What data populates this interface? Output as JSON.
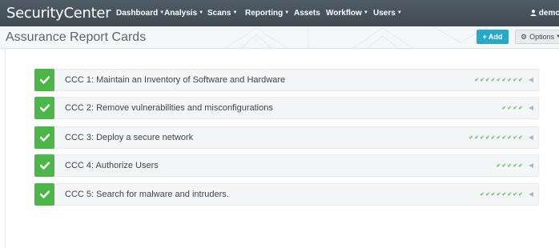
{
  "navbar": {
    "brand": "SecurityCenter",
    "items": [
      {
        "label": "Dashboard",
        "dropdown": true
      },
      {
        "label": "Analysis",
        "dropdown": true
      },
      {
        "label": "Scans",
        "dropdown": true
      },
      {
        "label": "Reporting",
        "dropdown": true
      },
      {
        "label": "Assets",
        "dropdown": false
      },
      {
        "label": "Workflow",
        "dropdown": true
      },
      {
        "label": "Users",
        "dropdown": true
      }
    ],
    "user": "demo",
    "user_icon": "user-icon"
  },
  "header": {
    "title": "Assurance Report Cards",
    "add_label": "Add",
    "options_label": "Options"
  },
  "cards": [
    {
      "label": "CCC 1: Maintain an Inventory of Software and Hardware",
      "checks": 9
    },
    {
      "label": "CCC 2: Remove vulnerabilities and misconfigurations",
      "checks": 4
    },
    {
      "label": "CCC 3: Deploy a secure network",
      "checks": 10
    },
    {
      "label": "CCC 4: Authorize Users",
      "checks": 5
    },
    {
      "label": "CCC 5: Search for malware and intruders.",
      "checks": 8
    }
  ],
  "colors": {
    "navbar": "#47525b",
    "accent": "#29a9c9",
    "success": "#4db648"
  }
}
